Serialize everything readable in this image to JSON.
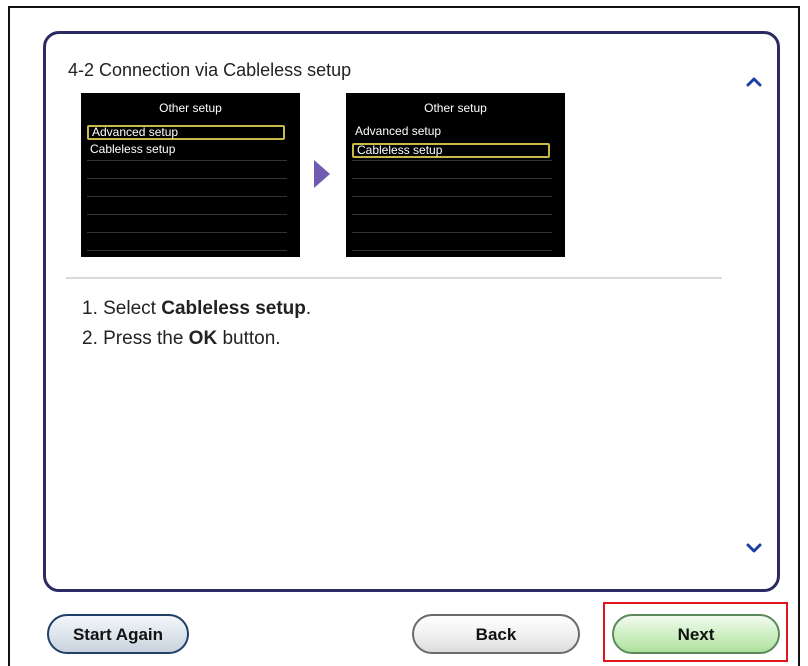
{
  "step": {
    "title": "4-2 Connection via Cableless setup"
  },
  "screens": {
    "left": {
      "title": "Other setup",
      "items": [
        "Advanced setup",
        "Cableless setup"
      ],
      "selected_index": 0
    },
    "right": {
      "title": "Other setup",
      "items": [
        "Advanced setup",
        "Cableless setup"
      ],
      "selected_index": 1
    }
  },
  "instructions": {
    "line1_prefix": "1. Select ",
    "line1_bold": "Cableless setup",
    "line1_suffix": ".",
    "line2_prefix": "2. Press the ",
    "line2_bold": "OK",
    "line2_suffix": " button."
  },
  "buttons": {
    "start_again": "Start Again",
    "back": "Back",
    "next": "Next"
  },
  "icons": {
    "scroll_up": "chevron-up-icon",
    "scroll_down": "chevron-down-icon",
    "arrow": "arrow-right-icon"
  },
  "colors": {
    "panel_border": "#2c2a63",
    "chevron": "#1a3fa8",
    "selection": "#c9b84a",
    "arrow": "#6f5bb0",
    "highlight": "#e0141c"
  }
}
